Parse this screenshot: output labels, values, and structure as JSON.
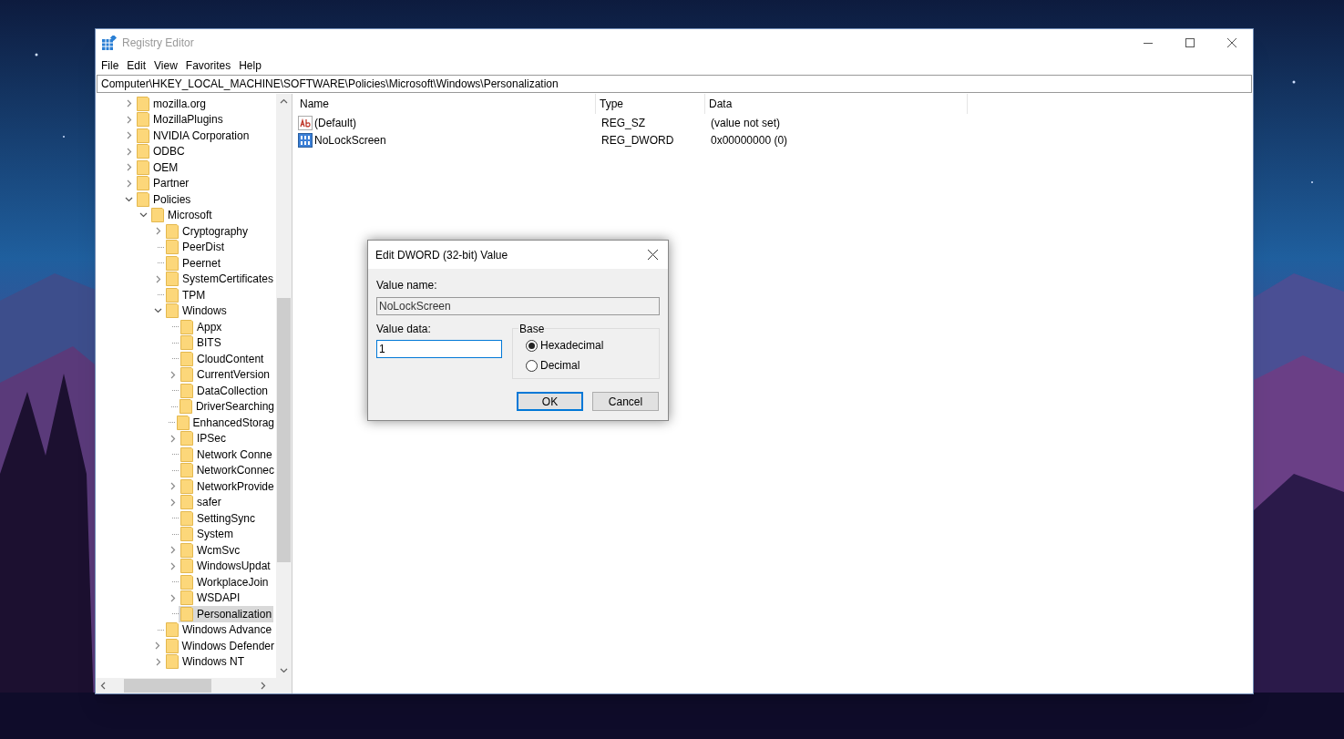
{
  "window": {
    "title": "Registry Editor"
  },
  "menu": [
    "File",
    "Edit",
    "View",
    "Favorites",
    "Help"
  ],
  "address": "Computer\\HKEY_LOCAL_MACHINE\\SOFTWARE\\Policies\\Microsoft\\Windows\\Personalization",
  "tree": [
    {
      "label": "mozilla.org",
      "expanded": false,
      "selected": false
    },
    {
      "label": "MozillaPlugins",
      "expanded": false,
      "selected": false
    },
    {
      "label": "NVIDIA Corporation",
      "expanded": false,
      "selected": false
    },
    {
      "label": "ODBC",
      "expanded": false,
      "selected": false
    },
    {
      "label": "OEM",
      "expanded": false,
      "selected": false
    },
    {
      "label": "Partner",
      "expanded": false,
      "selected": false
    },
    {
      "label": "Policies",
      "expanded": true,
      "selected": false,
      "children": [
        {
          "label": "Microsoft",
          "expanded": true,
          "selected": false,
          "children": [
            {
              "label": "Cryptography",
              "expanded": false,
              "selected": false
            },
            {
              "label": "PeerDist",
              "selected": false
            },
            {
              "label": "Peernet",
              "selected": false
            },
            {
              "label": "SystemCertificates",
              "expanded": false,
              "selected": false
            },
            {
              "label": "TPM",
              "selected": false
            },
            {
              "label": "Windows",
              "expanded": true,
              "selected": false,
              "children": [
                {
                  "label": "Appx",
                  "selected": false
                },
                {
                  "label": "BITS",
                  "selected": false
                },
                {
                  "label": "CloudContent",
                  "selected": false
                },
                {
                  "label": "CurrentVersion",
                  "expanded": false,
                  "selected": false
                },
                {
                  "label": "DataCollection",
                  "selected": false
                },
                {
                  "label": "DriverSearching",
                  "selected": false
                },
                {
                  "label": "EnhancedStorag",
                  "selected": false
                },
                {
                  "label": "IPSec",
                  "expanded": false,
                  "selected": false
                },
                {
                  "label": "Network Conne",
                  "selected": false
                },
                {
                  "label": "NetworkConnec",
                  "selected": false
                },
                {
                  "label": "NetworkProvide",
                  "expanded": false,
                  "selected": false
                },
                {
                  "label": "safer",
                  "expanded": false,
                  "selected": false
                },
                {
                  "label": "SettingSync",
                  "selected": false
                },
                {
                  "label": "System",
                  "selected": false
                },
                {
                  "label": "WcmSvc",
                  "expanded": false,
                  "selected": false
                },
                {
                  "label": "WindowsUpdat",
                  "expanded": false,
                  "selected": false
                },
                {
                  "label": "WorkplaceJoin",
                  "selected": false
                },
                {
                  "label": "WSDAPI",
                  "expanded": false,
                  "selected": false
                },
                {
                  "label": "Personalization",
                  "selected": true
                }
              ]
            },
            {
              "label": "Windows Advance",
              "selected": false
            },
            {
              "label": "Windows Defender",
              "expanded": false,
              "selected": false
            },
            {
              "label": "Windows NT",
              "expanded": false,
              "selected": false
            }
          ]
        }
      ]
    }
  ],
  "values": {
    "columns": [
      "Name",
      "Type",
      "Data"
    ],
    "rows": [
      {
        "kind": "string",
        "name": "(Default)",
        "type": "REG_SZ",
        "data": "(value not set)"
      },
      {
        "kind": "binary",
        "name": "NoLockScreen",
        "type": "REG_DWORD",
        "data": "0x00000000 (0)"
      }
    ]
  },
  "dialog": {
    "title": "Edit DWORD (32-bit) Value",
    "name_label": "Value name:",
    "name_value": "NoLockScreen",
    "data_label": "Value data:",
    "data_value": "1",
    "base": {
      "label": "Base",
      "options": [
        {
          "label": "Hexadecimal",
          "selected": true
        },
        {
          "label": "Decimal",
          "selected": false
        }
      ]
    },
    "buttons": [
      {
        "label": "OK",
        "default": true
      },
      {
        "label": "Cancel",
        "default": false
      }
    ]
  }
}
